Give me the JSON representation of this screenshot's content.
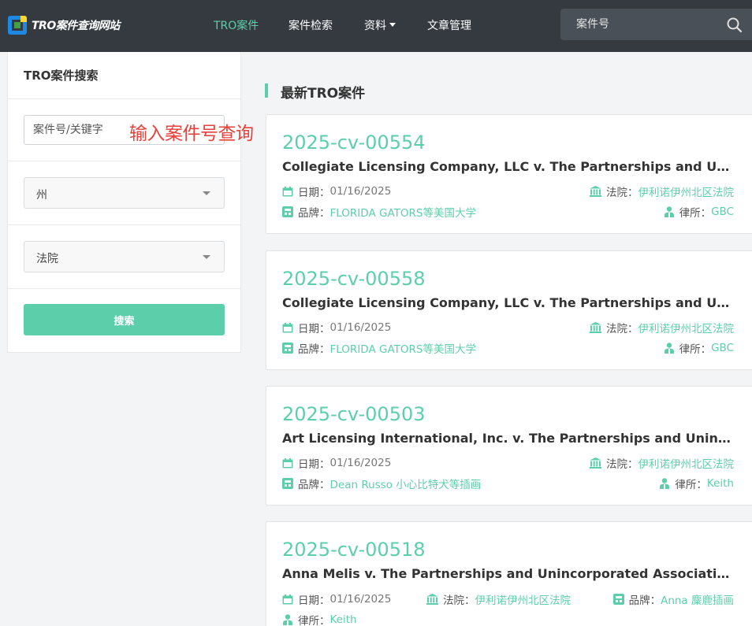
{
  "brand": {
    "name": "TRO案件查询网站",
    "accent": "#5ccfaa",
    "hint_color": "#e8413a"
  },
  "nav": {
    "items": [
      {
        "label": "TRO案件",
        "active": true
      },
      {
        "label": "案件检索",
        "active": false
      },
      {
        "label": "资料",
        "active": false,
        "dropdown": true
      },
      {
        "label": "文章管理",
        "active": false
      }
    ],
    "search_placeholder": "案件号",
    "search_icon": "search-icon"
  },
  "sidebar": {
    "title": "TRO案件搜索",
    "keyword_placeholder": "案件号/关键字",
    "hint": "输入案件号查询",
    "state_select": "州",
    "court_select": "法院",
    "search_button": "搜索"
  },
  "main": {
    "section_title": "最新TRO案件",
    "labels": {
      "date": "日期：",
      "court": "法院：",
      "brand": "品牌：",
      "firm": "律所："
    },
    "cases": [
      {
        "number": "2025-cv-00554",
        "title": "Collegiate Licensing Company, LLC v. The Partnerships and Unincorporated Associations Identified on Schedule A",
        "date": "01/16/2025",
        "court": "伊利诺伊州北区法院",
        "brand": "FLORIDA GATORS等美国大学",
        "firm": "GBC"
      },
      {
        "number": "2025-cv-00558",
        "title": "Collegiate Licensing Company, LLC v. The Partnerships and Unincorporated Associations Identified on Schedule A",
        "date": "01/16/2025",
        "court": "伊利诺伊州北区法院",
        "brand": "FLORIDA GATORS等美国大学",
        "firm": "GBC"
      },
      {
        "number": "2025-cv-00503",
        "title": "Art Licensing International, Inc. v. The Partnerships and Unincorporated Associations Identified on Schedule A",
        "date": "01/16/2025",
        "court": "伊利诺伊州北区法院",
        "brand": "Dean Russo 小心比特犬等插画",
        "firm": "Keith"
      },
      {
        "number": "2025-cv-00518",
        "title": "Anna Melis v. The Partnerships and Unincorporated Associations Identified on Schedule A",
        "date": "01/16/2025",
        "court": "伊利诺伊州北区法院",
        "brand": "Anna 麋鹿插画",
        "firm": "Keith"
      }
    ]
  }
}
